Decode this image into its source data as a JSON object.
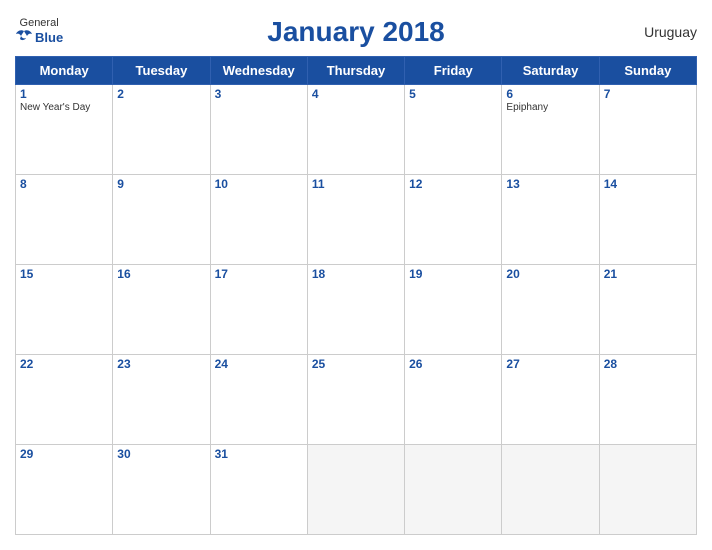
{
  "header": {
    "logo_general": "General",
    "logo_blue": "Blue",
    "title": "January 2018",
    "country": "Uruguay"
  },
  "weekdays": [
    "Monday",
    "Tuesday",
    "Wednesday",
    "Thursday",
    "Friday",
    "Saturday",
    "Sunday"
  ],
  "weeks": [
    [
      {
        "day": "1",
        "holiday": "New Year's Day",
        "empty": false
      },
      {
        "day": "2",
        "holiday": "",
        "empty": false
      },
      {
        "day": "3",
        "holiday": "",
        "empty": false
      },
      {
        "day": "4",
        "holiday": "",
        "empty": false
      },
      {
        "day": "5",
        "holiday": "",
        "empty": false
      },
      {
        "day": "6",
        "holiday": "Epiphany",
        "empty": false
      },
      {
        "day": "7",
        "holiday": "",
        "empty": false
      }
    ],
    [
      {
        "day": "8",
        "holiday": "",
        "empty": false
      },
      {
        "day": "9",
        "holiday": "",
        "empty": false
      },
      {
        "day": "10",
        "holiday": "",
        "empty": false
      },
      {
        "day": "11",
        "holiday": "",
        "empty": false
      },
      {
        "day": "12",
        "holiday": "",
        "empty": false
      },
      {
        "day": "13",
        "holiday": "",
        "empty": false
      },
      {
        "day": "14",
        "holiday": "",
        "empty": false
      }
    ],
    [
      {
        "day": "15",
        "holiday": "",
        "empty": false
      },
      {
        "day": "16",
        "holiday": "",
        "empty": false
      },
      {
        "day": "17",
        "holiday": "",
        "empty": false
      },
      {
        "day": "18",
        "holiday": "",
        "empty": false
      },
      {
        "day": "19",
        "holiday": "",
        "empty": false
      },
      {
        "day": "20",
        "holiday": "",
        "empty": false
      },
      {
        "day": "21",
        "holiday": "",
        "empty": false
      }
    ],
    [
      {
        "day": "22",
        "holiday": "",
        "empty": false
      },
      {
        "day": "23",
        "holiday": "",
        "empty": false
      },
      {
        "day": "24",
        "holiday": "",
        "empty": false
      },
      {
        "day": "25",
        "holiday": "",
        "empty": false
      },
      {
        "day": "26",
        "holiday": "",
        "empty": false
      },
      {
        "day": "27",
        "holiday": "",
        "empty": false
      },
      {
        "day": "28",
        "holiday": "",
        "empty": false
      }
    ],
    [
      {
        "day": "29",
        "holiday": "",
        "empty": false
      },
      {
        "day": "30",
        "holiday": "",
        "empty": false
      },
      {
        "day": "31",
        "holiday": "",
        "empty": false
      },
      {
        "day": "",
        "holiday": "",
        "empty": true
      },
      {
        "day": "",
        "holiday": "",
        "empty": true
      },
      {
        "day": "",
        "holiday": "",
        "empty": true
      },
      {
        "day": "",
        "holiday": "",
        "empty": true
      }
    ]
  ]
}
